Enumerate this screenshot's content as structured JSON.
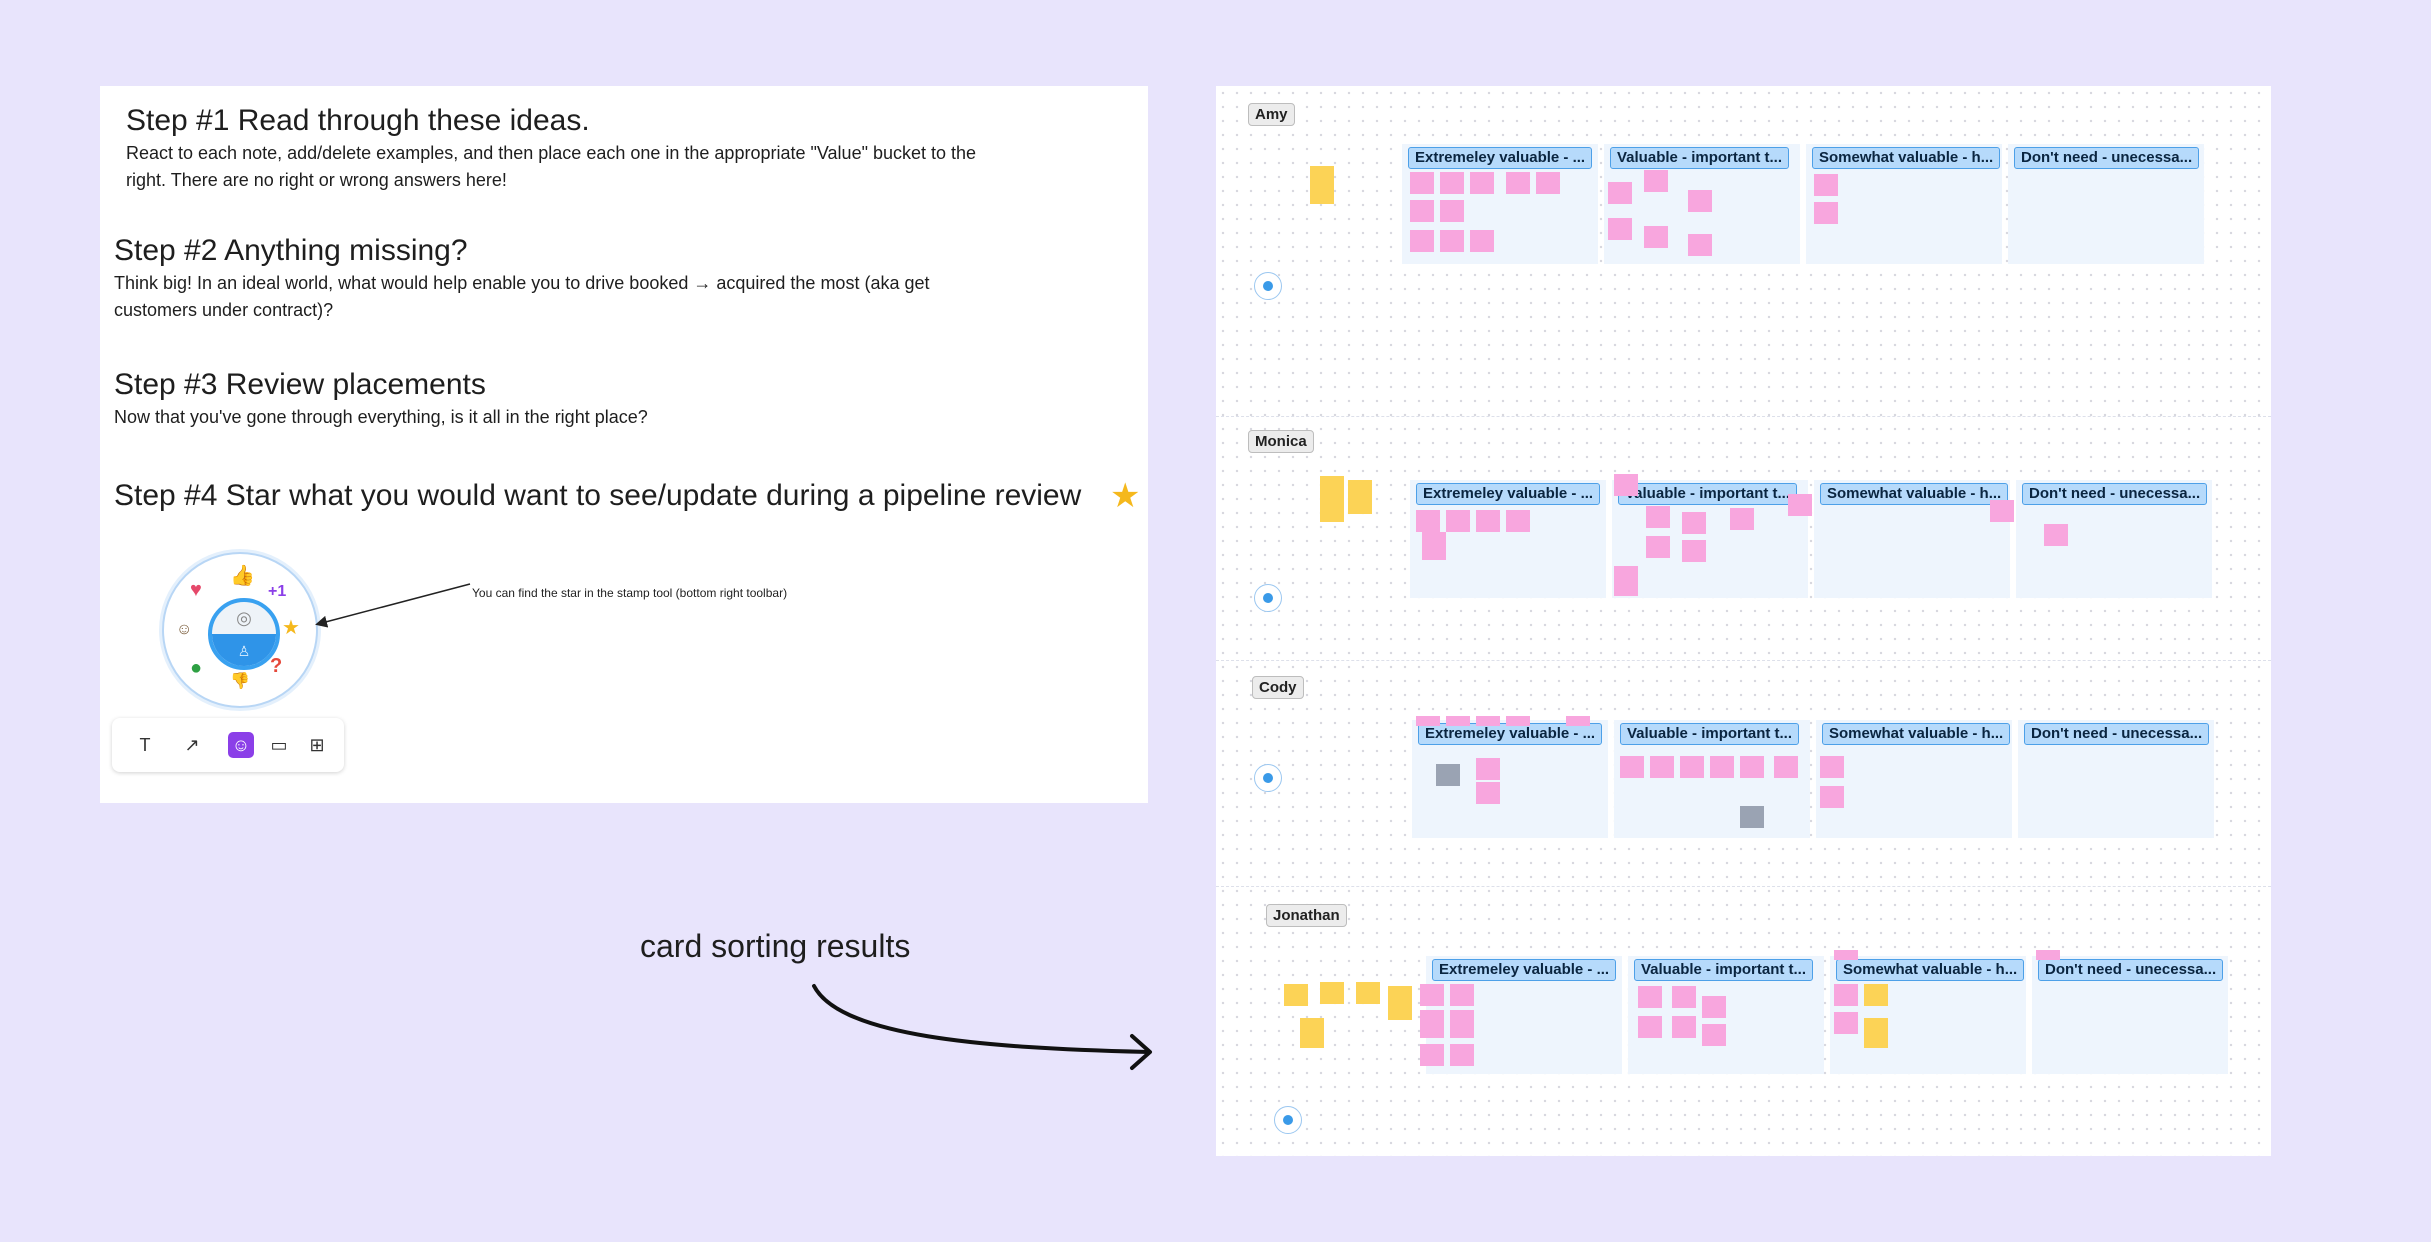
{
  "instructions": {
    "step1": {
      "title": "Step #1 Read through these ideas.",
      "body": "React to each note, add/delete examples, and then place each one in the appropriate \"Value\" bucket to the right. There are no right or wrong answers here!"
    },
    "step2": {
      "title": "Step #2 Anything missing?",
      "body": "Think big! In an ideal world, what would help enable you to drive booked → acquired the most (aka get customers under contract)?"
    },
    "step3": {
      "title": "Step #3 Review placements",
      "body": "Now that you've gone through everything, is it all in the right place?"
    },
    "step4": {
      "title": "Step #4 Star what you would want to see/update during a pipeline review",
      "star_icon": "★"
    },
    "stamp_callout": "You can find the star in the stamp tool (bottom right toolbar)",
    "stamps": {
      "heart": "♥",
      "thumbs_up": "👍",
      "plus_one": "+1",
      "star": "★",
      "question": "?",
      "thumbs_down": "👎",
      "blob": "●",
      "avatar": "☺"
    },
    "toolbar": {
      "items": [
        {
          "icon": "text-icon",
          "glyph": "T"
        },
        {
          "icon": "connector-icon",
          "glyph": "↗"
        },
        {
          "icon": "stamp-icon",
          "glyph": "☺",
          "active": true
        },
        {
          "icon": "frame-icon",
          "glyph": "▭"
        },
        {
          "icon": "table-icon",
          "glyph": "⊞"
        }
      ]
    }
  },
  "annotation": {
    "label": "card sorting results"
  },
  "boards": [
    {
      "name": "Amy"
    },
    {
      "name": "Monica"
    },
    {
      "name": "Cody"
    },
    {
      "name": "Jonathan"
    }
  ],
  "columns": {
    "extremely": "Extremeley valuable - ...",
    "valuable": "Valuable - important t...",
    "somewhat": "Somewhat valuable - h...",
    "dont_need": "Don't need - unecessa..."
  },
  "colors": {
    "background": "#e8e4fc",
    "sticky_pink": "#f8a6de",
    "sticky_yellow": "#fcd356",
    "column_label": "#b6dafb",
    "accent_purple": "#8b3fe8",
    "stamp_blue": "#2f94e8"
  }
}
